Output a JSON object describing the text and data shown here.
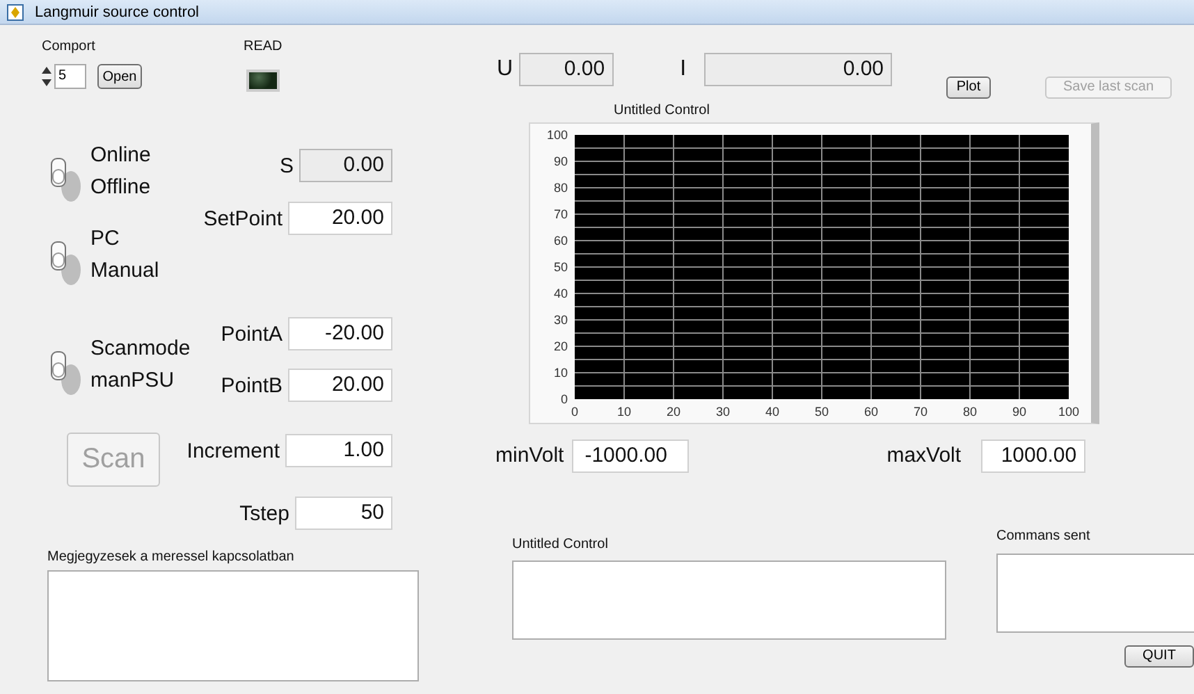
{
  "window": {
    "title": "Langmuir source control"
  },
  "comport": {
    "label": "Comport",
    "value": "5",
    "button": {
      "label": "Open",
      "disabled": false
    }
  },
  "read_indicator": {
    "label": "READ",
    "lit": false
  },
  "toggles": [
    {
      "top_label": "Online",
      "bottom_label": "Offline",
      "on": false
    },
    {
      "top_label": "PC",
      "bottom_label": "Manual",
      "on": false
    },
    {
      "top_label": "Scanmode",
      "bottom_label": "manPSU",
      "on": false
    }
  ],
  "scan_button": {
    "label": "Scan",
    "disabled": true
  },
  "fields": [
    {
      "label": "S",
      "value": "0.00",
      "kind": "indicator"
    },
    {
      "label": "SetPoint",
      "value": "20.00",
      "kind": "control"
    },
    {
      "label": "PointA",
      "value": "-20.00",
      "kind": "control"
    },
    {
      "label": "PointB",
      "value": "20.00",
      "kind": "control"
    },
    {
      "label": "Increment",
      "value": "1.00",
      "kind": "control"
    },
    {
      "label": "Tstep",
      "value": "50",
      "kind": "control"
    }
  ],
  "notes": {
    "label": "Megjegyzesek a meressel kapcsolatban"
  },
  "readouts": [
    {
      "label": "U",
      "value": "0.00"
    },
    {
      "label": "I",
      "value": "0.00"
    }
  ],
  "buttons": [
    {
      "label": "Plot",
      "disabled": false
    },
    {
      "label": "Save last scan",
      "disabled": true
    }
  ],
  "graph": {
    "chart_data": {
      "type": "line",
      "title": "Untitled Control",
      "xlim": [
        0,
        100
      ],
      "ylim": [
        0,
        100
      ],
      "grid": true,
      "xticks": [
        0,
        10,
        20,
        30,
        40,
        50,
        60,
        70,
        80,
        90,
        100
      ],
      "yticks": [
        0,
        10,
        20,
        30,
        40,
        50,
        60,
        70,
        80,
        90,
        100
      ]
    }
  },
  "volt_fields": [
    {
      "label": "minVolt",
      "value": "-1000.00"
    },
    {
      "label": "maxVolt",
      "value": "1000.00"
    }
  ],
  "output_box": {
    "label": "Untitled Control"
  },
  "commands_box": {
    "label": "Commans sent"
  },
  "quit_button": {
    "label": "QUIT",
    "disabled": false
  }
}
